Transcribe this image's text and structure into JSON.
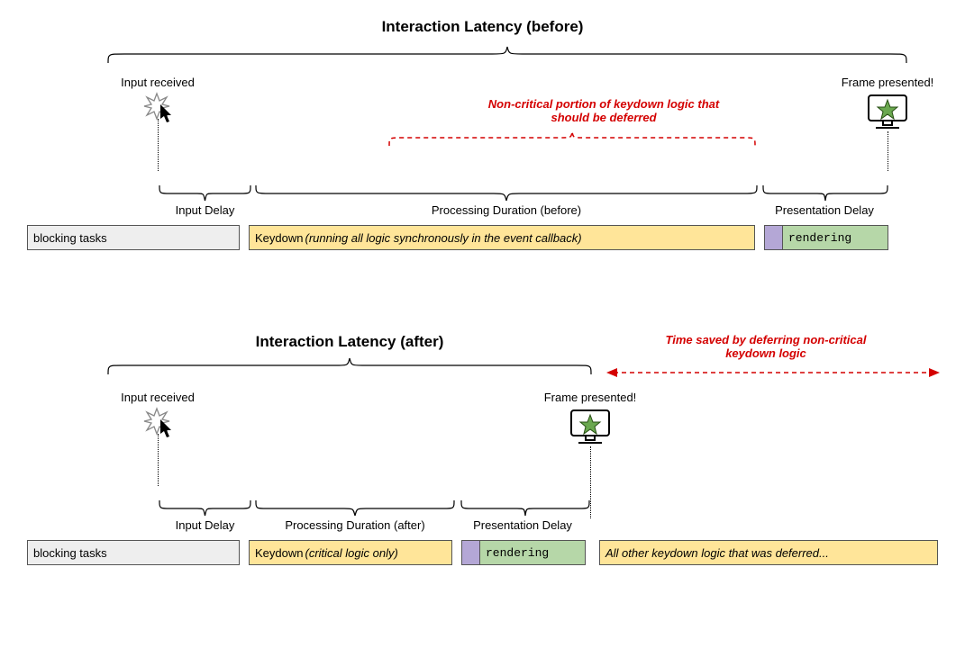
{
  "before": {
    "title": "Interaction Latency (before)",
    "input_received": "Input received",
    "frame_presented": "Frame presented!",
    "red_note": "Non-critical portion of keydown logic that should be deferred",
    "blocks": {
      "blocking": "blocking tasks",
      "keydown_prefix": "Keydown ",
      "keydown_italic": "(running all logic synchronously in the event callback)",
      "rendering": "rendering"
    },
    "braces": {
      "input_delay": "Input Delay",
      "processing": "Processing Duration (before)",
      "presentation": "Presentation Delay"
    }
  },
  "after": {
    "title": "Interaction Latency (after)",
    "input_received": "Input received",
    "frame_presented": "Frame presented!",
    "red_note": "Time saved by deferring non-critical keydown logic",
    "blocks": {
      "blocking": "blocking tasks",
      "keydown_prefix": "Keydown ",
      "keydown_italic": "(critical logic only)",
      "rendering": "rendering",
      "deferred": "All other keydown logic that was deferred..."
    },
    "braces": {
      "input_delay": "Input Delay",
      "processing": "Processing Duration (after)",
      "presentation": "Presentation Delay"
    }
  }
}
